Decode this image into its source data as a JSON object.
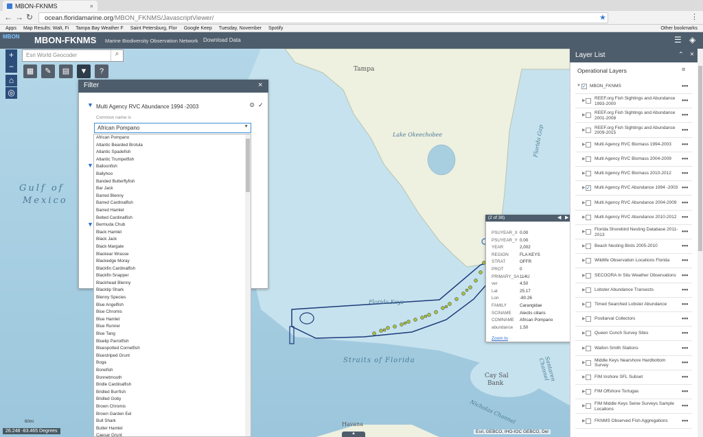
{
  "browser": {
    "tab_title": "MBON-FKNMS",
    "url_host": "ocean.floridamarine.org",
    "url_path": "/MBON_FKNMS/JavascriptViewer/",
    "bookmarks": [
      "Apps",
      "Map Results: Walt, Fi",
      "Tampa Bay Weather F",
      "Saint Petersburg, Flor",
      "Google Keep",
      "Tuesday, November",
      "Spotify",
      "Other bookmarks"
    ]
  },
  "header": {
    "logo": "MBON",
    "title": "MBON-FKNMS",
    "subtitle": "Marine Biodiversity Observation Network",
    "download": "Download Data"
  },
  "search": {
    "placeholder": "Esri World Geocoder"
  },
  "map_labels": {
    "tampa": "Tampa",
    "gulf1": "Gulf of",
    "gulf2": "Mexico",
    "okeechobee": "Lake Okeechobee",
    "florida_gap": "Florida Gap",
    "florida_keys": "Florida Keys",
    "straits": "Straits of Florida",
    "cay_sal": "Cay Sal",
    "bank": "Bank",
    "nicholas": "Nicholas Channel",
    "santaren": "Santaren Channel",
    "havana": "Havana"
  },
  "filter": {
    "title": "Filter",
    "layer_name": "Multi Agency RVC Abundance 1994 -2003",
    "field_label": "Common name is",
    "selected": "African Pompano",
    "options": [
      "African Pompano",
      "Atlantic Bearded Brotula",
      "Atlantic Spadefish",
      "Atlantic Trumpetfish",
      "Balloonfish",
      "Ballyhoo",
      "Banded Butterflyfish",
      "Bar Jack",
      "Barred Blenny",
      "Barred Cardinalfish",
      "Barred Hamlet",
      "Belted Cardinalfish",
      "Bermuda Chub",
      "Black Hamlet",
      "Black Jack",
      "Black Margate",
      "Blackear Wrasse",
      "Blackedge Moray",
      "Blackfin Cardinalfish",
      "Blackfin Snapper",
      "Blackhead Blenny",
      "Blacktip Shark",
      "Blenny Species",
      "Blue Angelfish",
      "Blue Chromis",
      "Blue Hamlet",
      "Blue Runner",
      "Blue Tang",
      "Bluelip Parrotfish",
      "Bluespotted Cornetfish",
      "Bluestriped Grunt",
      "Boga",
      "Bonefish",
      "Bonnetmouth",
      "Bridle Cardinalfish",
      "Bridled Burrfish",
      "Bridled Goby",
      "Brown Chromis",
      "Brown Garden Eel",
      "Bull Shark",
      "Butter Hamlet",
      "Caesar Grunt"
    ]
  },
  "popup": {
    "counter": "(2 of 38)",
    "rows": [
      {
        "k": "PSUYEAR_X",
        "v": "0.00"
      },
      {
        "k": "PSUYEAR_Y",
        "v": "0.00"
      },
      {
        "k": "YEAR",
        "v": "2,002"
      },
      {
        "k": "REGION",
        "v": "FLA KEYS"
      },
      {
        "k": "STRAT",
        "v": "OFFR"
      },
      {
        "k": "PROT",
        "v": "0"
      },
      {
        "k": "PRIMARY_SA",
        "v": "114U"
      },
      {
        "k": "ver",
        "v": "4.50"
      },
      {
        "k": "Lat",
        "v": "25.17"
      },
      {
        "k": "Lon",
        "v": "-80.26"
      },
      {
        "k": "FAMILY",
        "v": "Carangidae"
      },
      {
        "k": "SCINAME",
        "v": "Alectis ciliaris"
      },
      {
        "k": "COMNAME",
        "v": "African Pompano"
      },
      {
        "k": "abundance",
        "v": "1.50"
      }
    ],
    "zoom_to": "Zoom to"
  },
  "layers": {
    "title": "Layer List",
    "operational": "Operational Layers",
    "items": [
      {
        "name": "MBON_FKNMS",
        "checked": true
      },
      {
        "name": "REEF.org Fish Sightings and Abundance 1993-2000",
        "checked": false
      },
      {
        "name": "REEF.org Fish Sightings and Abundance 2001-2008",
        "checked": false
      },
      {
        "name": "REEF.org Fish Sightings and Abundance 2009-2015",
        "checked": false
      },
      {
        "name": "Multi Agency RVC Biomass 1994-2003",
        "checked": false
      },
      {
        "name": "Multi Agency RVC Biomass 2004-2009",
        "checked": false
      },
      {
        "name": "Multi Agency RVC Biomass 2010-2012",
        "checked": false
      },
      {
        "name": "Multi Agency RVC Abundance 1994 -2003",
        "checked": true
      },
      {
        "name": "Multi Agency RVC Abundance 2004-2009",
        "checked": false
      },
      {
        "name": "Multi Agency RVC Abundance 2010-2012",
        "checked": false
      },
      {
        "name": "Florida Shorebird Nesting Database 2011-2013",
        "checked": false
      },
      {
        "name": "Beach Nesting Birds 2005-2010",
        "checked": false
      },
      {
        "name": "Wildlife Observation Locations Florida",
        "checked": false
      },
      {
        "name": "SECOORA In Situ Weather Observations",
        "checked": false
      },
      {
        "name": "Lobster Abundance Transects",
        "checked": false
      },
      {
        "name": "Timed Searched Lobster Abundance",
        "checked": false
      },
      {
        "name": "Postlarval Collectors",
        "checked": false
      },
      {
        "name": "Queen Conch Survey Sites",
        "checked": false
      },
      {
        "name": "Walton Smith Stations",
        "checked": false
      },
      {
        "name": "Middle Keys Nearshore Hardbottom Survey",
        "checked": false
      },
      {
        "name": "FIM Inshore SFL Subset",
        "checked": false
      },
      {
        "name": "FIM Offshore Tortugas",
        "checked": false
      },
      {
        "name": "FIM Middle Keys Seine Surveys Sample Locations",
        "checked": false
      },
      {
        "name": "FKNMS Observed Fish Aggregations",
        "checked": false
      }
    ]
  },
  "status": {
    "coords": "26.248 -83.465 Degrees",
    "attribution": "Esri, GEBCO, IHO-IOC GEBCO, Del",
    "scale": "60mi"
  }
}
